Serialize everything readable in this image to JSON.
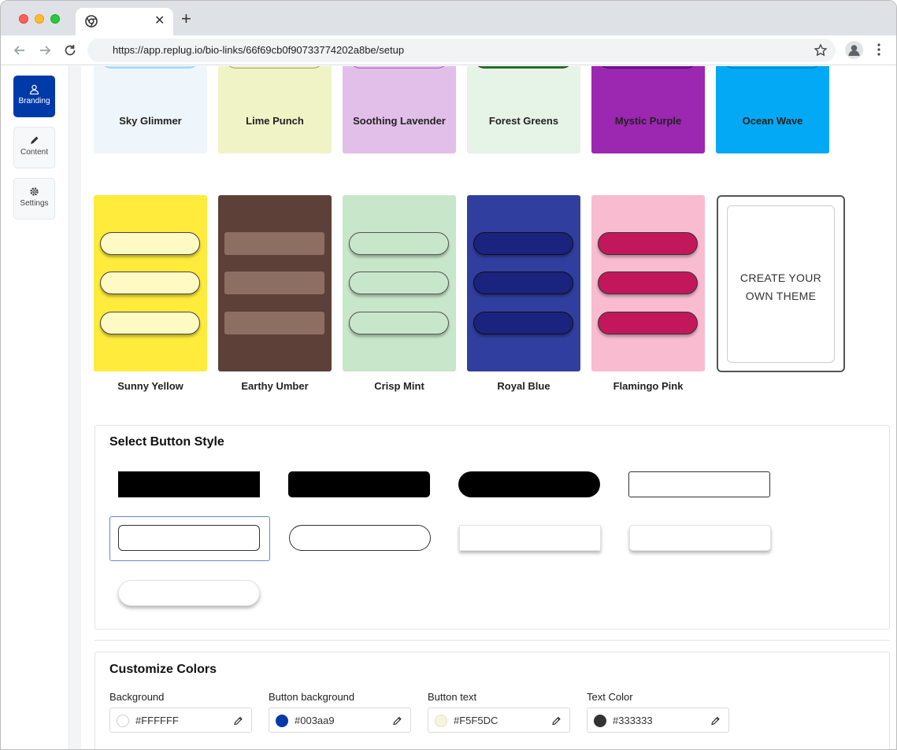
{
  "browser": {
    "url": "https://app.replug.io/bio-links/66f69cb0f90733774202a8be/setup"
  },
  "sidebar": {
    "items": [
      {
        "label": "Branding",
        "active": true,
        "icon": "user-icon"
      },
      {
        "label": "Content",
        "active": false,
        "icon": "pencil-icon"
      },
      {
        "label": "Settings",
        "active": false,
        "icon": "gear-icon"
      }
    ]
  },
  "themes": {
    "row1": [
      {
        "name": "Sky Glimmer",
        "bg": "#eef6fb",
        "pill": "#b7e3fb",
        "border": "#8fcdf0"
      },
      {
        "name": "Lime Punch",
        "bg": "#f0f3c6",
        "pill": "#eef0c0",
        "border": "#a99a6a"
      },
      {
        "name": "Soothing Lavender",
        "bg": "#e2bfe9",
        "pill": "#e2bfe9",
        "border": "#9d62b0"
      },
      {
        "name": "Forest Greens",
        "bg": "#e6f3e7",
        "pill": "#2e7d32",
        "border": "#1b3f1d"
      },
      {
        "name": "Mystic Purple",
        "bg": "#9c27b0",
        "pill": "#7b1fa2",
        "border": "#3c0d4f"
      },
      {
        "name": "Ocean Wave",
        "bg": "#03a9f4",
        "pill": "#03a9f4",
        "border": "#0a6fa0"
      }
    ],
    "row2": [
      {
        "name": "Sunny Yellow",
        "bg": "#ffeb3b",
        "pill": "#fff9c4",
        "border": "#444444"
      },
      {
        "name": "Earthy Umber",
        "bg": "#5d4037",
        "pill": "#8d6e63",
        "border": "#8d6e63"
      },
      {
        "name": "Crisp Mint",
        "bg": "#c8e6c9",
        "pill": "#c8e6c9",
        "border": "#555555"
      },
      {
        "name": "Royal Blue",
        "bg": "#303f9f",
        "pill": "#1a237e",
        "border": "#111111"
      },
      {
        "name": "Flamingo Pink",
        "bg": "#f8bbd0",
        "pill": "#c2185b",
        "border": "#333333"
      }
    ],
    "create_label_1": "CREATE YOUR",
    "create_label_2": "OWN THEME"
  },
  "button_style": {
    "title": "Select Button Style",
    "selected_index": 4
  },
  "customize_colors": {
    "title": "Customize Colors",
    "fields": [
      {
        "label": "Background",
        "value": "#FFFFFF",
        "swatch": "#FFFFFF"
      },
      {
        "label": "Button background",
        "value": "#003aa9",
        "swatch": "#003aa9"
      },
      {
        "label": "Button text",
        "value": "#F5F5DC",
        "swatch": "#F5F5DC"
      },
      {
        "label": "Text Color",
        "value": "#333333",
        "swatch": "#333333"
      }
    ]
  },
  "colors": {
    "accent": "#003aa9"
  }
}
